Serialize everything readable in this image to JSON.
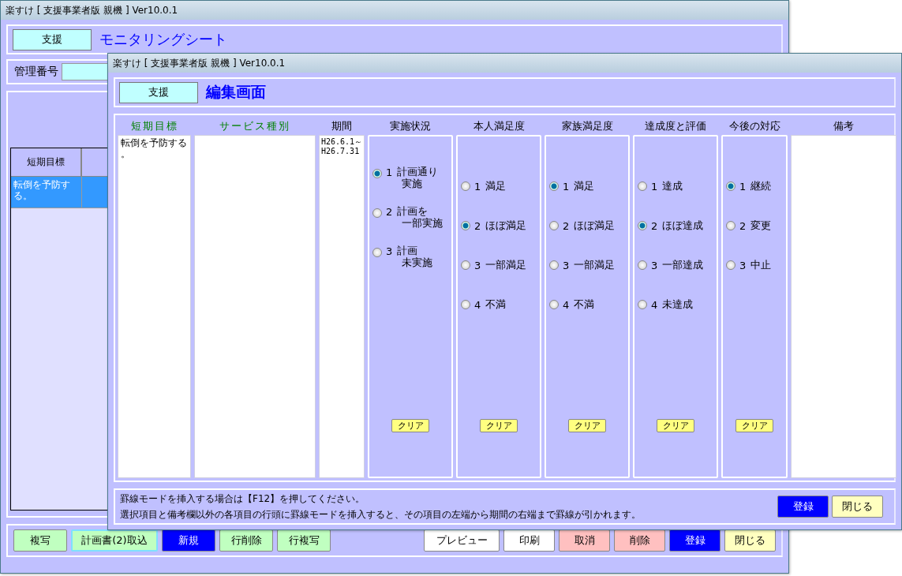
{
  "back_window": {
    "title": "楽すけ [ 支援事業者版 親機 ] Ver10.0.1",
    "badge": "支援",
    "heading": "モニタリングシート",
    "management_number": {
      "label": "管理番号"
    },
    "table": {
      "columns": [
        "短期目標"
      ],
      "rows": [
        {
          "cells": [
            "転倒を予防する。"
          ],
          "selected": true
        }
      ]
    },
    "toolbar_left": [
      {
        "label": "複写",
        "kind": "green",
        "focused": false
      },
      {
        "label": "計画書(2)取込",
        "kind": "green",
        "focused": true
      },
      {
        "label": "新規",
        "kind": "blue",
        "focused": false
      },
      {
        "label": "行削除",
        "kind": "green",
        "focused": false
      },
      {
        "label": "行複写",
        "kind": "green",
        "focused": false
      }
    ],
    "toolbar_right": [
      {
        "label": "プレビュー",
        "kind": "white",
        "focused": false
      },
      {
        "label": "印刷",
        "kind": "white",
        "focused": false
      },
      {
        "label": "取消",
        "kind": "pink",
        "focused": false
      },
      {
        "label": "削除",
        "kind": "pink",
        "focused": false
      },
      {
        "label": "登録",
        "kind": "blue",
        "focused": false
      },
      {
        "label": "閉じる",
        "kind": "yellow",
        "focused": false
      }
    ]
  },
  "dialog": {
    "title": "楽すけ [ 支援事業者版 親機 ] Ver10.0.1",
    "badge": "支援",
    "heading": "編集画面",
    "columns": [
      {
        "kind": "input",
        "header": "短期目標",
        "value": "転倒を予防する。"
      },
      {
        "kind": "input",
        "header": "サービス種別"
      },
      {
        "kind": "readonly",
        "header": "期間",
        "value": "H26.6.1～\nH26.7.31"
      },
      {
        "kind": "radio",
        "header": "実施状況",
        "clear": "クリア",
        "options": [
          {
            "number": "1",
            "lines": [
              "計画通り",
              "実施"
            ],
            "selected": true
          },
          {
            "number": "2",
            "lines": [
              "計画を",
              "一部実施"
            ],
            "selected": false
          },
          {
            "number": "3",
            "lines": [
              "計画",
              "未実施"
            ],
            "selected": false
          }
        ]
      },
      {
        "kind": "radio",
        "header": "本人満足度",
        "clear": "クリア",
        "options": [
          {
            "number": "1",
            "text": "満足",
            "selected": false
          },
          {
            "number": "2",
            "text": "ほぼ満足",
            "selected": true
          },
          {
            "number": "3",
            "text": "一部満足",
            "selected": false
          },
          {
            "number": "4",
            "text": "不満",
            "selected": false
          }
        ]
      },
      {
        "kind": "radio",
        "header": "家族満足度",
        "clear": "クリア",
        "options": [
          {
            "number": "1",
            "text": "満足",
            "selected": true
          },
          {
            "number": "2",
            "text": "ほぼ満足",
            "selected": false
          },
          {
            "number": "3",
            "text": "一部満足",
            "selected": false
          },
          {
            "number": "4",
            "text": "不満",
            "selected": false
          }
        ]
      },
      {
        "kind": "radio",
        "header": "達成度と評価",
        "clear": "クリア",
        "options": [
          {
            "number": "1",
            "text": "達成",
            "selected": false
          },
          {
            "number": "2",
            "text": "ほぼ達成",
            "selected": true
          },
          {
            "number": "3",
            "text": "一部達成",
            "selected": false
          },
          {
            "number": "4",
            "text": "未達成",
            "selected": false
          }
        ]
      },
      {
        "kind": "radio",
        "header": "今後の対応",
        "clear": "クリア",
        "options": [
          {
            "number": "1",
            "text": "継続",
            "selected": true
          },
          {
            "number": "2",
            "text": "変更",
            "selected": false
          },
          {
            "number": "3",
            "text": "中止",
            "selected": false
          }
        ]
      },
      {
        "kind": "memo",
        "header": "備考"
      }
    ],
    "notes": [
      "罫線モードを挿入する場合は【F12】を押してください。",
      "選択項目と備考欄以外の各項目の行頭に罫線モードを挿入すると、その項目の左端から期間の右端まで罫線が引かれます。"
    ],
    "buttons": [
      {
        "label": "登録",
        "kind": "blue"
      },
      {
        "label": "閉じる",
        "kind": "yellow"
      }
    ]
  }
}
